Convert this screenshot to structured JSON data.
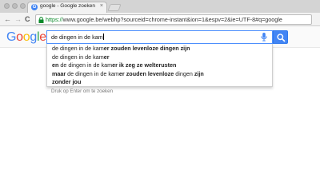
{
  "browser": {
    "tab_title": "google - Google zoeken",
    "tab_favicon_letter": "G",
    "tab_close": "×",
    "url_scheme": "https://",
    "url_rest": "www.google.be/webhp?sourceid=chrome-instant&ion=1&espv=2&ie=UTF-8#q=google",
    "back_glyph": "←",
    "forward_glyph": "→",
    "reload_glyph": "C"
  },
  "google": {
    "logo_letters": [
      "G",
      "o",
      "o",
      "g",
      "l",
      "e"
    ],
    "logo_colors": [
      "#4285F4",
      "#EA4335",
      "#FBBC05",
      "#4285F4",
      "#34A853",
      "#EA4335"
    ],
    "search_value": "de dingen in de kam",
    "search_button_color": "#4285F4",
    "hint": "Druk op Enter om te zoeken"
  },
  "suggestions": [
    {
      "pre": "de dingen in de kam",
      "bold": "er zouden levenloze dingen zijn",
      "post": ""
    },
    {
      "pre": "de dingen in de kam",
      "bold": "er",
      "post": ""
    },
    {
      "pre": "",
      "bold": "en",
      "post": " de dingen in de kam",
      "bold2": "er ik zeg ze welterusten"
    },
    {
      "pre": "",
      "bold": "maar",
      "post": " de dingen in de kam",
      "bold2": "er zouden levenloze",
      "tail": " dingen ",
      "bold3": "zijn"
    },
    {
      "pre": "",
      "bold": "zonder jou",
      "post": ""
    }
  ]
}
